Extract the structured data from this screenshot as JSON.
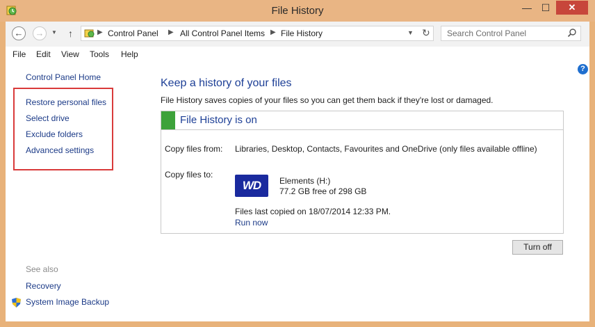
{
  "window": {
    "title": "File History"
  },
  "titlebar": {
    "minimize": "—",
    "maximize": "☐",
    "close": "✕"
  },
  "address": {
    "crumbs": [
      "Control Panel",
      "All Control Panel Items",
      "File History"
    ],
    "separator": "▶"
  },
  "search": {
    "placeholder": "Search Control Panel"
  },
  "menu": {
    "items": [
      "File",
      "Edit",
      "View",
      "Tools",
      "Help"
    ]
  },
  "left": {
    "home": "Control Panel Home",
    "links": [
      "Restore personal files",
      "Select drive",
      "Exclude folders",
      "Advanced settings"
    ],
    "see_also_label": "See also",
    "see_also": [
      "Recovery",
      "System Image Backup"
    ]
  },
  "main": {
    "heading": "Keep a history of your files",
    "description": "File History saves copies of your files so you can get them back if they're lost or damaged.",
    "status": "File History is on",
    "copy_from_label": "Copy files from:",
    "copy_from_value": "Libraries, Desktop, Contacts, Favourites and OneDrive (only files available offline)",
    "copy_to_label": "Copy files to:",
    "drive_logo_text": "WD",
    "drive_name": "Elements (H:)",
    "drive_free": "77.2 GB free of 298 GB",
    "last_copied": "Files last copied on 18/07/2014 12:33 PM.",
    "run_now": "Run now",
    "turn_off": "Turn off"
  },
  "help": {
    "label": "?"
  },
  "colors": {
    "accent_link": "#1b3a87",
    "heading": "#1d3f96",
    "status_green": "#3da23a",
    "highlight_red": "#d93a3a",
    "frame": "#e8b27a"
  },
  "icons": [
    "file-history-app-icon",
    "back-arrow-icon",
    "forward-arrow-icon",
    "dropdown-icon",
    "up-arrow-icon",
    "control-panel-icon",
    "refresh-icon",
    "search-icon",
    "help-icon",
    "shield-icon",
    "wd-drive-icon"
  ]
}
